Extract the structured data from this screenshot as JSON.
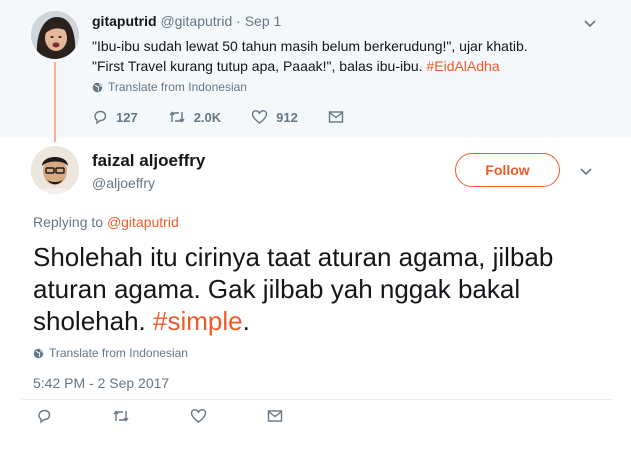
{
  "parent_tweet": {
    "name": "gitaputrid",
    "handle": "@gitaputrid",
    "separator": "·",
    "date": "Sep 1",
    "line1": "\"Ibu-ibu sudah lewat 50 tahun masih belum berkerudung!\", ujar khatib.",
    "line2_prefix": "\"First Travel kurang tutup apa, Paaak!\", balas ibu-ibu. ",
    "hashtag": "#EidAlAdha",
    "translate": "Translate from Indonesian",
    "reply_count": "127",
    "retweet_count": "2.0K",
    "like_count": "912"
  },
  "main_tweet": {
    "name": "faizal aljoeffry",
    "handle": "@aljoeffry",
    "follow_label": "Follow",
    "replying_prefix": "Replying to ",
    "replying_mention": "@gitaputrid",
    "text_prefix": "Sholehah itu cirinya taat aturan agama, jilbab aturan agama. Gak jilbab yah nggak bakal sholehah. ",
    "hashtag": "#simple",
    "text_suffix": ".",
    "translate": "Translate from Indonesian",
    "timestamp": "5:42 PM - 2 Sep 2017"
  },
  "colors": {
    "accent": "#f05a28",
    "muted": "#657786",
    "thread_line": "#fbb094",
    "parent_bg": "#f5f8fa"
  },
  "icons": [
    "chevron-down-icon",
    "globe-icon",
    "reply-icon",
    "retweet-icon",
    "like-icon",
    "dm-icon"
  ]
}
